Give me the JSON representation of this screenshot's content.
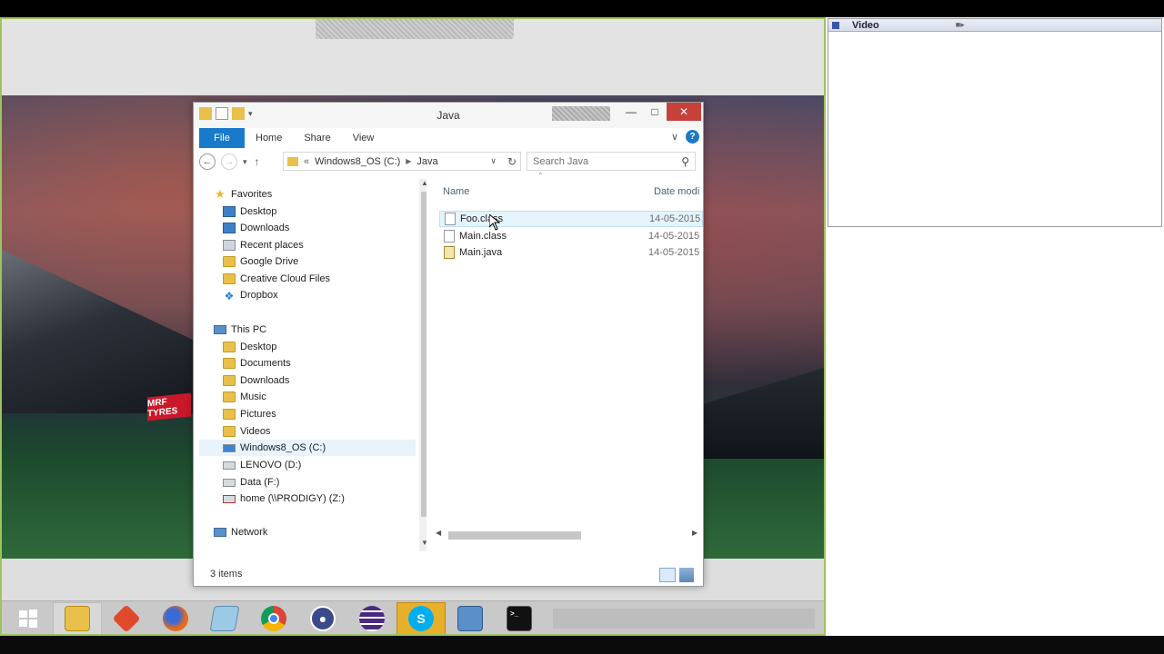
{
  "explorer": {
    "title": "Java",
    "ribbon_tabs": [
      "File",
      "Home",
      "Share",
      "View"
    ],
    "address": {
      "prefix": "«",
      "segment1": "Windows8_OS (C:)",
      "segment2": "Java"
    },
    "search_placeholder": "Search Java",
    "favorites_header": "Favorites",
    "favorites": [
      "Desktop",
      "Downloads",
      "Recent places",
      "Google Drive",
      "Creative Cloud Files",
      "Dropbox"
    ],
    "thispc_header": "This PC",
    "thispc": [
      "Desktop",
      "Documents",
      "Downloads",
      "Music",
      "Pictures",
      "Videos",
      "Windows8_OS (C:)",
      "LENOVO (D:)",
      "Data (F:)",
      "home (\\\\PRODIGY) (Z:)"
    ],
    "network_label": "Network",
    "columns": {
      "name": "Name",
      "date": "Date modi"
    },
    "files": [
      {
        "name": "Foo.class",
        "date": "14-05-2015"
      },
      {
        "name": "Main.class",
        "date": "14-05-2015"
      },
      {
        "name": "Main.java",
        "date": "14-05-2015"
      }
    ],
    "status": "3 items"
  },
  "video_panel": {
    "title": "Video"
  },
  "wallpaper": {
    "sign_text": "MRF TYRES"
  },
  "taskbar": {
    "apps": [
      "start-icon",
      "file-explorer-icon",
      "git-icon",
      "firefox-icon",
      "app-icon",
      "chrome-icon",
      "keepass-icon",
      "eclipse-icon",
      "skype-icon",
      "remote-desktop-icon",
      "terminal-icon"
    ]
  }
}
